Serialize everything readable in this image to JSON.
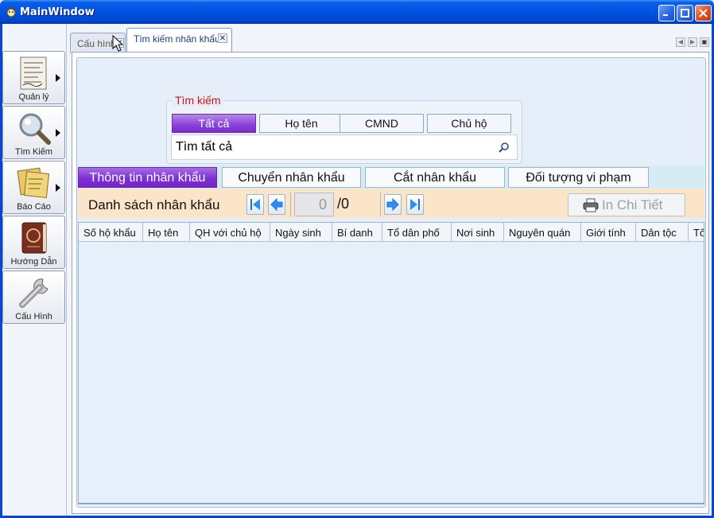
{
  "window": {
    "title": "MainWindow"
  },
  "nav": [
    {
      "label": "Quản lý",
      "icon": "document-icon",
      "has_submenu": true
    },
    {
      "label": "Tìm Kiếm",
      "icon": "magnifier-icon",
      "has_submenu": true
    },
    {
      "label": "Báo Cáo",
      "icon": "notes-icon",
      "has_submenu": true
    },
    {
      "label": "Hướng Dẫn",
      "icon": "book-icon",
      "has_submenu": false
    },
    {
      "label": "Cấu Hình",
      "icon": "wrench-icon",
      "has_submenu": false
    }
  ],
  "tabs": [
    {
      "label": "Cấu hình",
      "active": false
    },
    {
      "label": "Tìm kiếm nhân khẩu",
      "active": true
    }
  ],
  "search": {
    "legend": "Tìm kiếm",
    "modes": [
      "Tất cả",
      "Họ tên",
      "CMND",
      "Chủ hộ"
    ],
    "active_mode": "Tất cả",
    "value": "Tìm tất cả"
  },
  "sections": [
    "Thông tin nhân khẩu",
    "Chuyển nhân khẩu",
    "Cắt nhân khẩu",
    "Đối tượng vi phạm"
  ],
  "toolbar": {
    "title": "Danh sách nhân khẩu",
    "page": "0",
    "total": "/0",
    "print_label": "In Chi Tiết"
  },
  "table": {
    "columns": [
      "Số hộ khẩu",
      "Họ tên",
      "QH với chủ hộ",
      "Ngày sinh",
      "Bí danh",
      "Tổ dân phố",
      "Nơi sinh",
      "Nguyên quán",
      "Giới tính",
      "Dân tộc",
      "Tô"
    ],
    "rows": []
  },
  "colors": {
    "accent_purple": "#7f2fd4",
    "legend_red": "#d81010",
    "toolbar_bg": "#fbe5c8",
    "titlebar_blue": "#0054e3"
  }
}
